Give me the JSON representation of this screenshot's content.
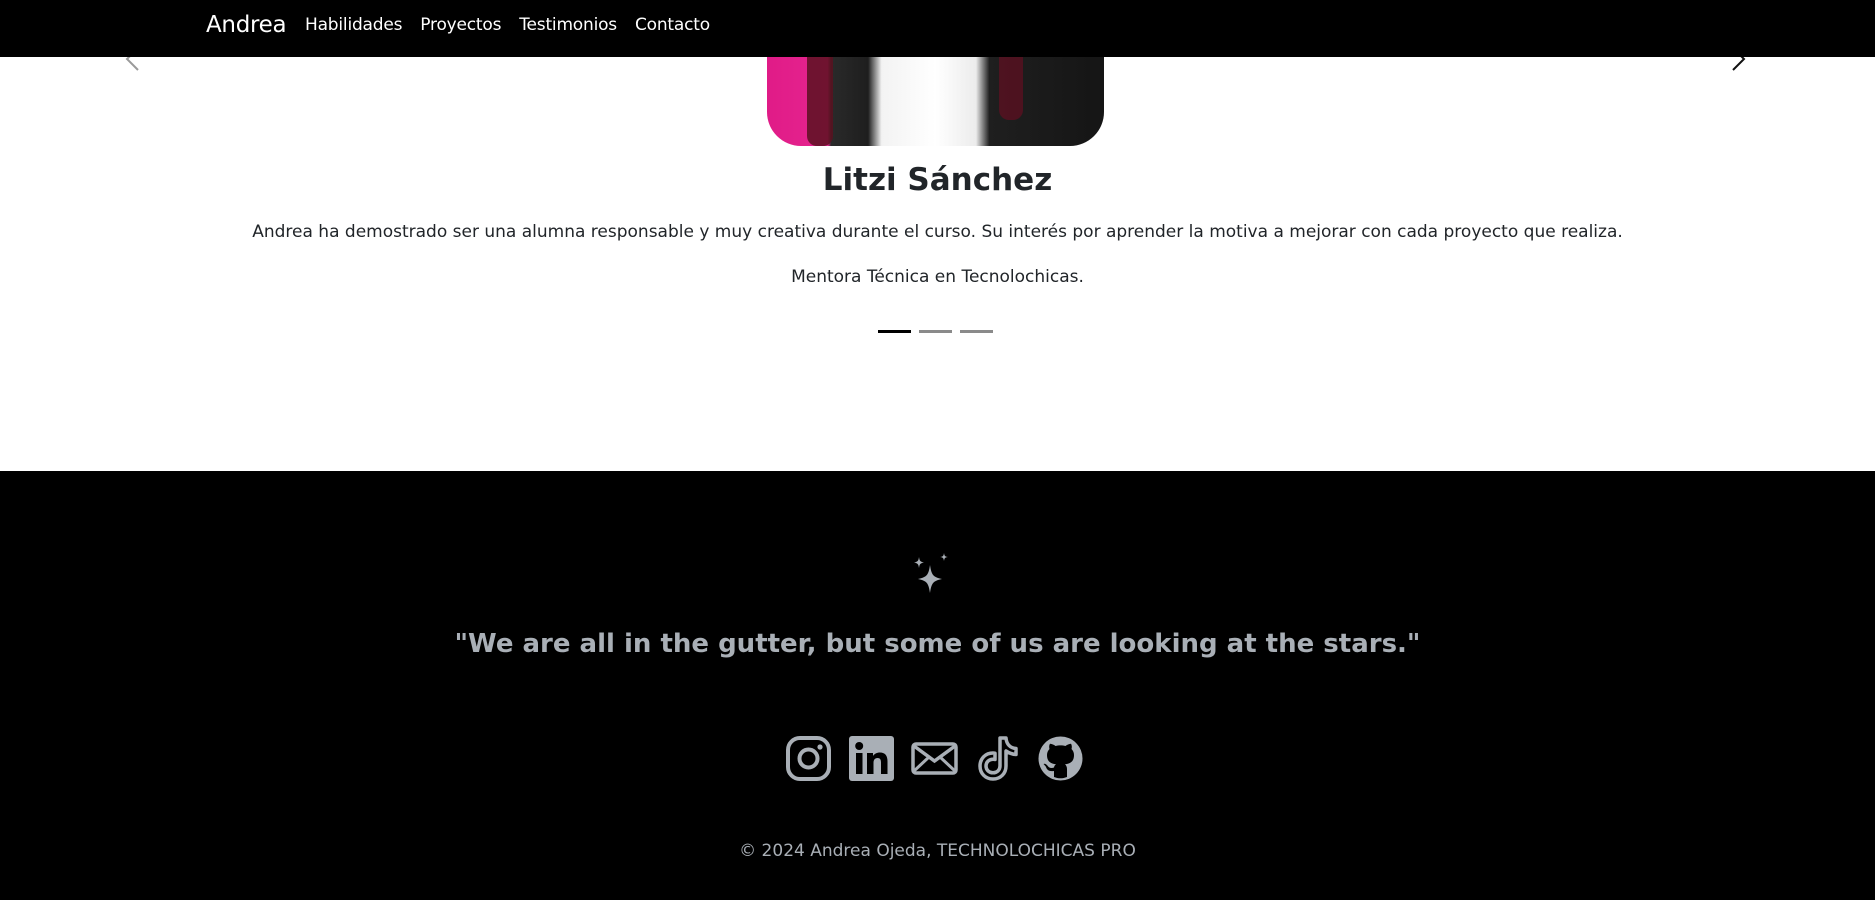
{
  "nav": {
    "brand": "Andrea",
    "links": [
      "Habilidades",
      "Proyectos",
      "Testimonios",
      "Contacto"
    ]
  },
  "testimonial": {
    "name": "Litzi Sánchez",
    "quote": "Andrea ha demostrado ser una alumna responsable y muy creativa durante el curso. Su interés por aprender la motiva a mejorar con cada proyecto que realiza.",
    "role": "Mentora Técnica en Tecnolochicas.",
    "photo_icon": "person-photo",
    "prev_icon": "chevron-left-icon",
    "next_icon": "chevron-right-icon",
    "indicator_count": 3,
    "active_indicator": 1
  },
  "footer": {
    "icon": "stars-icon",
    "quote": "\"We are all in the gutter, but some of us are looking at the stars.\"",
    "socials": [
      "instagram-icon",
      "linkedin-icon",
      "envelope-icon",
      "tiktok-icon",
      "github-icon"
    ],
    "copyright": "© 2024 Andrea Ojeda, TECHNOLOCHICAS PRO"
  },
  "colors": {
    "navbar_bg": "#000000",
    "footer_bg": "#000000",
    "footer_text": "#a9afb6",
    "accent_pink": "#e62590"
  }
}
